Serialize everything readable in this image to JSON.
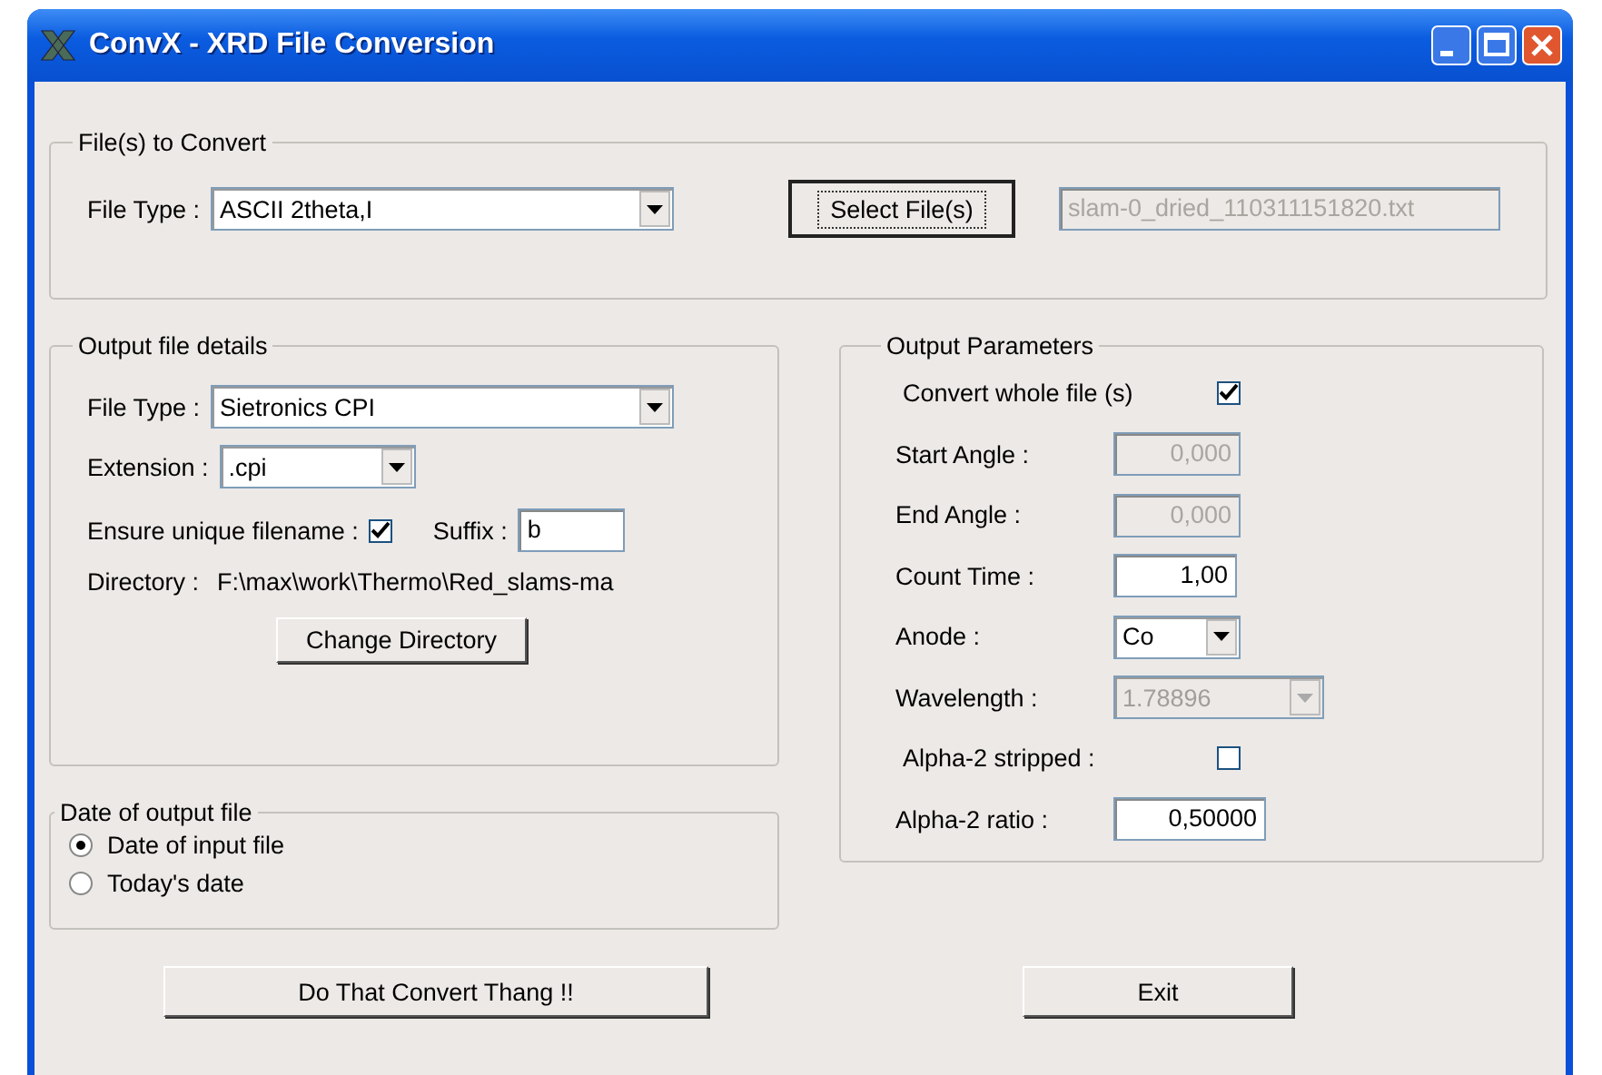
{
  "window": {
    "title": "ConvX - XRD File Conversion"
  },
  "files_group": {
    "title": "File(s) to Convert",
    "file_type": {
      "label": "File Type :",
      "value": "ASCII 2theta,I"
    },
    "select_button": "Select File(s)",
    "file_field": {
      "value": "slam-0_dried_110311151820.txt",
      "disabled": true
    }
  },
  "output_group": {
    "title": "Output file details",
    "file_type": {
      "label": "File Type :",
      "value": "Sietronics CPI"
    },
    "extension": {
      "label": "Extension :",
      "value": ".cpi"
    },
    "unique": {
      "label": "Ensure unique filename :",
      "checked": true
    },
    "suffix": {
      "label": "Suffix :",
      "value": "b"
    },
    "directory": {
      "label": "Directory :",
      "value": "F:\\max\\work\\Thermo\\Red_slams-ma"
    },
    "change_button": "Change Directory"
  },
  "date_group": {
    "title": "Date of output file",
    "options": [
      {
        "label": "Date of input file",
        "selected": true
      },
      {
        "label": "Today's date",
        "selected": false
      }
    ]
  },
  "params_group": {
    "title": "Output Parameters",
    "rows": [
      {
        "kind": "checkbox",
        "label": "Convert whole file (s)",
        "checked": true
      },
      {
        "kind": "text",
        "label": "Start Angle :",
        "value": "0,000",
        "disabled": true
      },
      {
        "kind": "text",
        "label": "End Angle :",
        "value": "0,000",
        "disabled": true
      },
      {
        "kind": "text",
        "label": "Count  Time :",
        "value": "1,00",
        "disabled": false
      },
      {
        "kind": "select",
        "label": "Anode :",
        "value": "Co",
        "disabled": false
      },
      {
        "kind": "select",
        "label": "Wavelength :",
        "value": "1.78896",
        "disabled": true
      },
      {
        "kind": "checkbox",
        "label": "Alpha-2 stripped :",
        "checked": false
      },
      {
        "kind": "text",
        "label": "Alpha-2 ratio :",
        "value": "0,50000",
        "disabled": false
      }
    ]
  },
  "buttons": [
    {
      "label": "Do That Convert Thang !!"
    },
    {
      "label": "Exit"
    }
  ]
}
